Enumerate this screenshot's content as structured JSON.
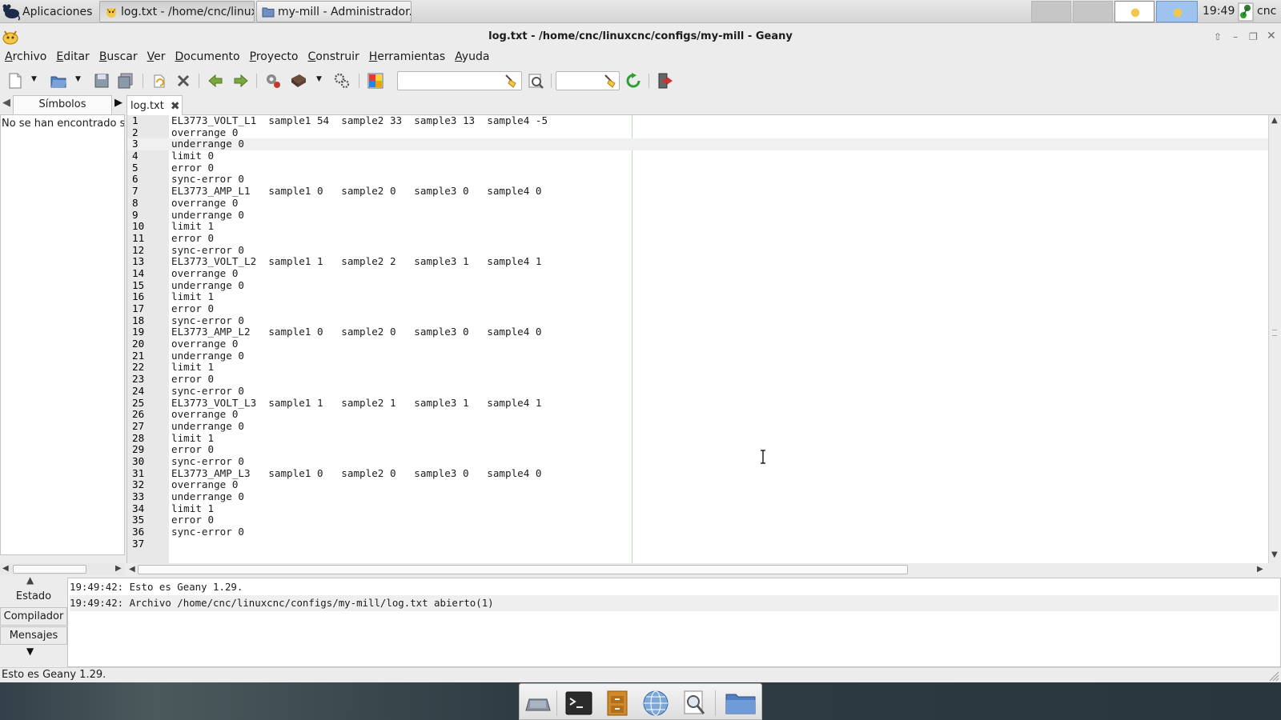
{
  "top_panel": {
    "apps_label": "Aplicaciones",
    "tasks": [
      {
        "label": "log.txt - /home/cnc/linux..."
      },
      {
        "label": "my-mill - Administrador..."
      }
    ],
    "clock": "19:49",
    "user": "cnc"
  },
  "window": {
    "title": "log.txt - /home/cnc/linuxcnc/configs/my-mill - Geany"
  },
  "menu": [
    "Archivo",
    "Editar",
    "Buscar",
    "Ver",
    "Documento",
    "Proyecto",
    "Construir",
    "Herramientas",
    "Ayuda"
  ],
  "toolbar": {
    "search_value": "",
    "goto_value": ""
  },
  "sidebar": {
    "tab_label": "Símbolos",
    "empty_message": "No se han encontrado s"
  },
  "editor": {
    "tab_label": "log.txt",
    "current_line": 3,
    "lines": [
      "EL3773_VOLT_L1  sample1 54  sample2 33  sample3 13  sample4 -5",
      "overrange 0",
      "underrange 0",
      "limit 0",
      "error 0",
      "sync-error 0",
      "EL3773_AMP_L1   sample1 0   sample2 0   sample3 0   sample4 0",
      "overrange 0",
      "underrange 0",
      "limit 1",
      "error 0",
      "sync-error 0",
      "EL3773_VOLT_L2  sample1 1   sample2 2   sample3 1   sample4 1",
      "overrange 0",
      "underrange 0",
      "limit 1",
      "error 0",
      "sync-error 0",
      "EL3773_AMP_L2   sample1 0   sample2 0   sample3 0   sample4 0",
      "overrange 0",
      "underrange 0",
      "limit 1",
      "error 0",
      "sync-error 0",
      "EL3773_VOLT_L3  sample1 1   sample2 1   sample3 1   sample4 1",
      "overrange 0",
      "underrange 0",
      "limit 1",
      "error 0",
      "sync-error 0",
      "EL3773_AMP_L3   sample1 0   sample2 0   sample3 0   sample4 0",
      "overrange 0",
      "underrange 0",
      "limit 1",
      "error 0",
      "sync-error 0",
      ""
    ]
  },
  "messages": {
    "tabs": [
      "Estado",
      "Compilador",
      "Mensajes"
    ],
    "active_tab": "Estado",
    "lines": [
      "19:49:42: Esto es Geany 1.29.",
      "19:49:42: Archivo /home/cnc/linuxcnc/configs/my-mill/log.txt abierto(1)"
    ]
  },
  "statusbar": {
    "text": "Esto es Geany 1.29."
  },
  "dock": {
    "apps": [
      "show-desktop-icon",
      "terminal-icon",
      "file-manager-icon",
      "web-browser-icon",
      "app-finder-icon",
      "folder-icon"
    ]
  },
  "colors": {
    "accent_green": "#2ea02e",
    "arrow_green": "#7aa640"
  }
}
